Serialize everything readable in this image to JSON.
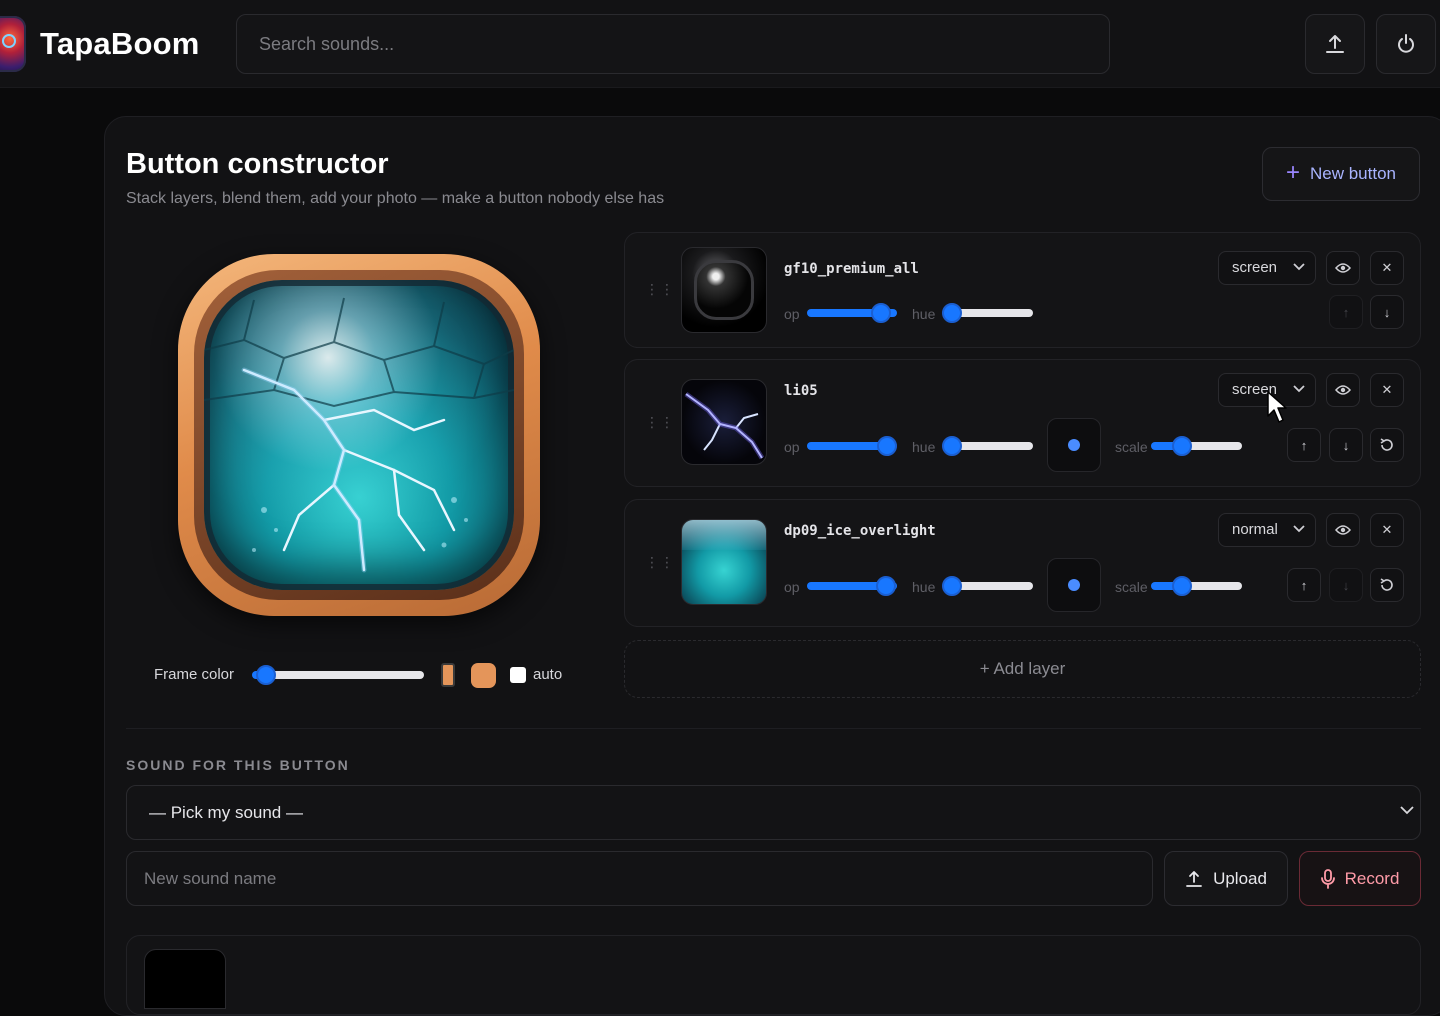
{
  "app": {
    "name": "TapaBoom"
  },
  "header": {
    "search_placeholder": "Search sounds...",
    "upload_icon": "upload-icon",
    "power_icon": "power-icon"
  },
  "constructor": {
    "title": "Button constructor",
    "subtitle": "Stack layers, blend them, add your photo — make a button nobody else has",
    "new_button_label": "New button",
    "frame_color_label": "Frame color",
    "auto_label": "auto",
    "frame_color": "#e4955a",
    "frame_hue_value": 0.1,
    "auto_checked": false
  },
  "layers": [
    {
      "name": "gf10_premium_all",
      "blend": "screen",
      "op_label": "op",
      "hue_label": "hue",
      "opacity": 0.82,
      "hue": 0.05,
      "visible": true
    },
    {
      "name": "li05",
      "blend": "screen",
      "op_label": "op",
      "hue_label": "hue",
      "scale_label": "scale",
      "opacity": 0.88,
      "hue": 0.05,
      "scale": 0.35,
      "visible": true
    },
    {
      "name": "dp09_ice_overlight",
      "blend": "normal",
      "op_label": "op",
      "hue_label": "hue",
      "scale_label": "scale",
      "opacity": 0.86,
      "hue": 0.05,
      "scale": 0.35,
      "visible": true
    }
  ],
  "add_layer_label": "+ Add layer",
  "sound": {
    "section_title": "SOUND FOR THIS BUTTON",
    "selected": "— Pick my sound —",
    "name_placeholder": "New sound name",
    "upload_label": "Upload",
    "record_label": "Record"
  },
  "colors": {
    "accent": "#1877ff",
    "record": "#ff9ba8",
    "new_button": "#a9b4ff"
  }
}
